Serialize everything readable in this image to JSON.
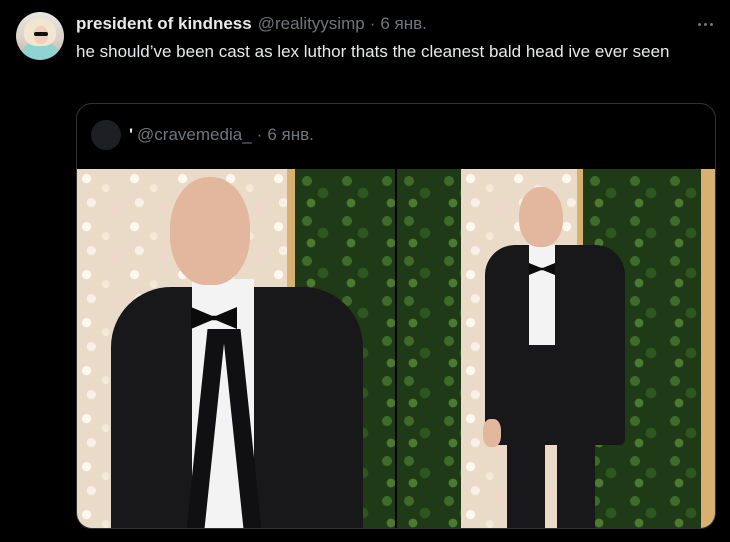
{
  "tweet": {
    "author_name": "president of kindness",
    "author_handle": "@realityysimp",
    "separator": "·",
    "date": "6 янв.",
    "text": "he should’ve been cast as lex luthor thats the cleanest bald head ive ever seen"
  },
  "quoted": {
    "author_name": "'",
    "author_handle": "@cravemedia_",
    "separator": "·",
    "date": "6 янв."
  },
  "icons": {
    "more": "more-horizontal-icon"
  },
  "colors": {
    "background": "#000000",
    "text_primary": "#e7e9ea",
    "text_secondary": "#71767b",
    "border": "#2f3336"
  }
}
